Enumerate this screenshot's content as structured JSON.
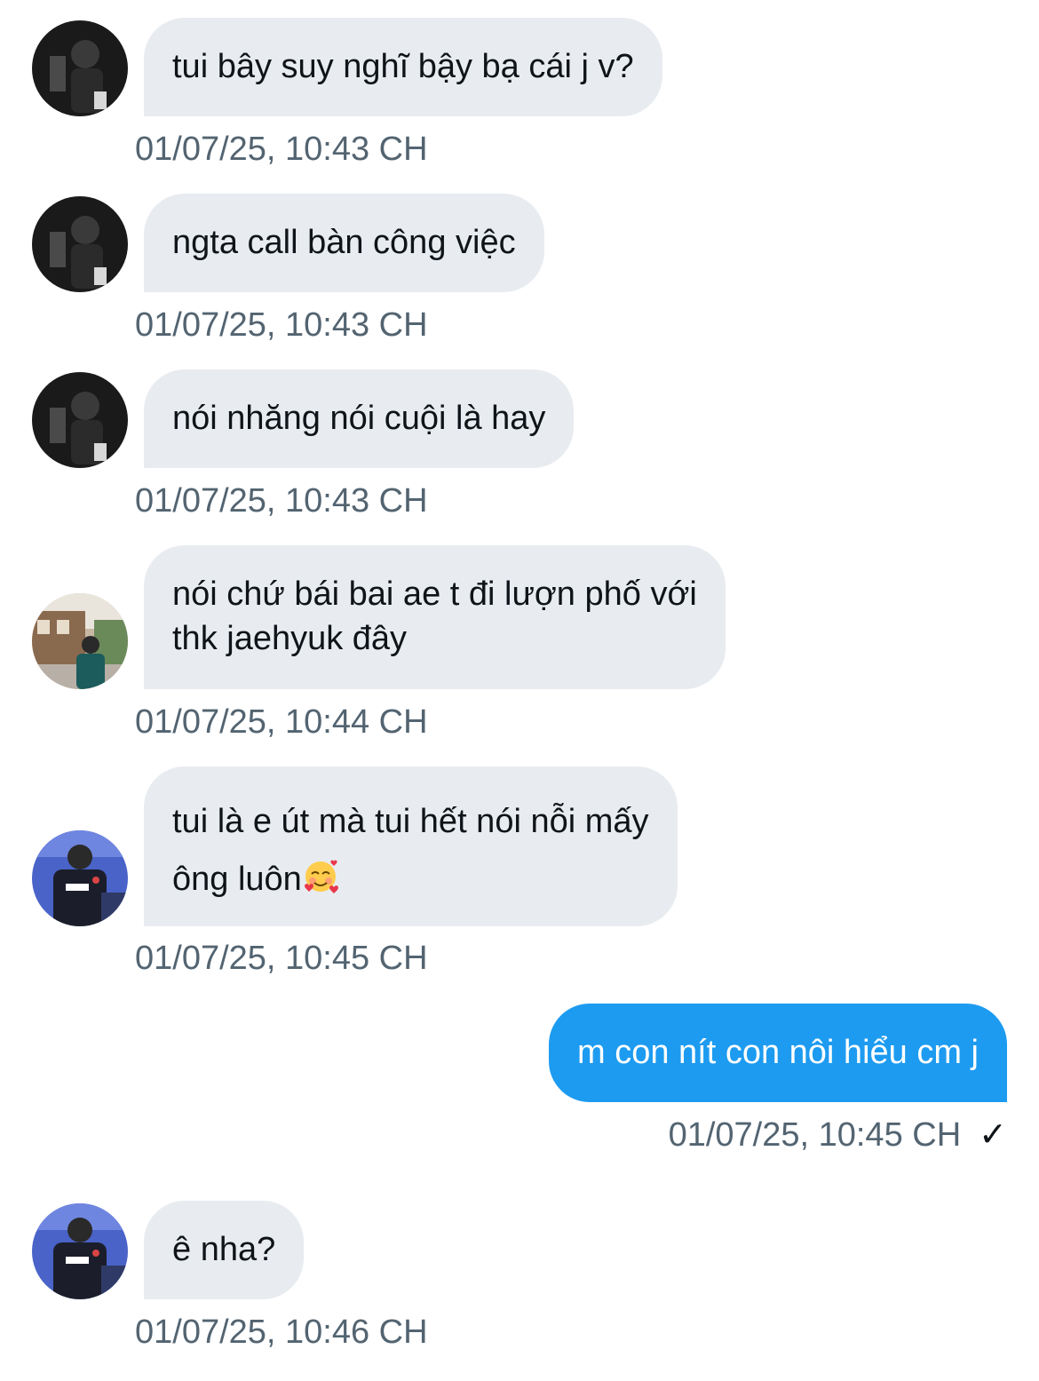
{
  "messages": [
    {
      "direction": "in",
      "avatar": "avatar-dark-portrait",
      "text": "tui bây suy nghĩ bậy bạ cái j v?",
      "timestamp": "01/07/25, 10:43 CH"
    },
    {
      "direction": "in",
      "avatar": "avatar-dark-portrait",
      "text": "ngta call bàn công việc",
      "timestamp": "01/07/25, 10:43 CH"
    },
    {
      "direction": "in",
      "avatar": "avatar-dark-portrait",
      "text": "nói nhăng nói cuội là hay",
      "timestamp": "01/07/25, 10:43 CH"
    },
    {
      "direction": "in",
      "avatar": "avatar-street-photo",
      "line1": "nói chứ bái bai ae t đi lượn phố với",
      "line2": "thk jaehyuk đây",
      "timestamp": "01/07/25, 10:44 CH"
    },
    {
      "direction": "in",
      "avatar": "avatar-esports-jersey",
      "line1": "tui là e út mà tui hết nói nỗi mấy",
      "line2": "ông luôn",
      "emoji": "smiling-face-with-hearts-emoji",
      "timestamp": "01/07/25, 10:45 CH"
    },
    {
      "direction": "out",
      "text": "m con nít con nôi hiểu cm j",
      "timestamp": "01/07/25, 10:45 CH",
      "status": "✓"
    },
    {
      "direction": "in",
      "avatar": "avatar-esports-jersey",
      "text": "ê nha?",
      "timestamp": "01/07/25, 10:46 CH"
    }
  ],
  "colors": {
    "incoming_bubble": "#e8ecf0",
    "outgoing_bubble": "#1d9bf0",
    "timestamp": "#536471",
    "text": "#0f1419"
  }
}
